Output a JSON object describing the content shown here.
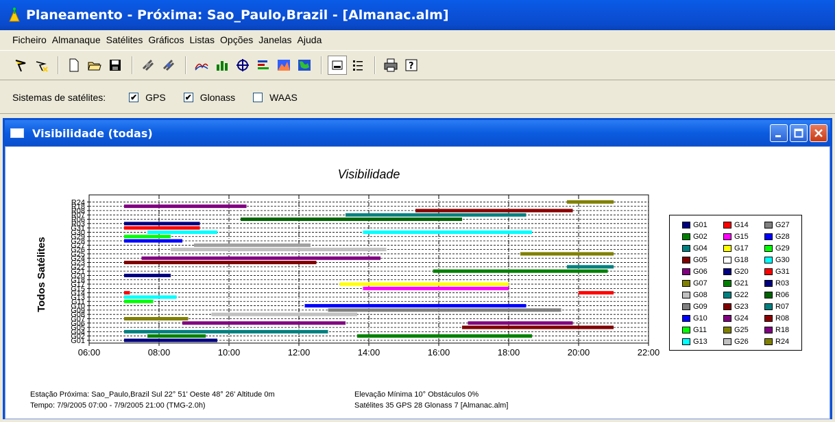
{
  "app": {
    "title": "Planeamento - Próxima: Sao_Paulo,Brazil - [Almanac.alm]"
  },
  "menu": [
    "Ficheiro",
    "Almanaque",
    "Satélites",
    "Gráficos",
    "Listas",
    "Opções",
    "Janelas",
    "Ajuda"
  ],
  "toolbar": {
    "icons": [
      "select-icon",
      "deselect-icon",
      "new-file-icon",
      "open-folder-icon",
      "save-icon",
      "satellite-icon",
      "satellite-alt-icon",
      "elevation-icon",
      "bar-chart-icon",
      "sky-plot-icon",
      "dop-icon",
      "visibility-icon",
      "world-map-icon",
      "view-toggle-icon",
      "list-icon",
      "print-icon",
      "help-icon"
    ]
  },
  "systems": {
    "label": "Sistemas de satélites:",
    "options": [
      {
        "label": "GPS",
        "checked": true
      },
      {
        "label": "Glonass",
        "checked": true
      },
      {
        "label": "WAAS",
        "checked": false
      }
    ]
  },
  "window": {
    "title": "Visibilidade (todas)"
  },
  "footer": {
    "line1_left": "Estação Próxima: Sao_Paulo,Brazil  Sul 22° 51'   Oeste 48° 26'   Altitude 0m",
    "line2_left": "Tempo: 7/9/2005 07:00 - 7/9/2005 21:00 (TMG-2.0h)",
    "line1_right": "Elevação Mínima 10°  Obstáculos 0%",
    "line2_right": "Satélites 35  GPS 28  Glonass 7  [Almanac.alm]"
  },
  "chart_data": {
    "type": "gantt",
    "title": "Visibilidade",
    "ylabel": "Todos Satélites",
    "xlabel": "",
    "x_range": [
      "06:00",
      "22:00"
    ],
    "x_ticks": [
      "06:00",
      "08:00",
      "10:00",
      "12:00",
      "14:00",
      "16:00",
      "18:00",
      "20:00",
      "22:00"
    ],
    "grid": true,
    "legend_position": "right",
    "rows": [
      {
        "name": "G01",
        "color": "#000080",
        "intervals": [
          [
            "07:00",
            "09:40"
          ]
        ]
      },
      {
        "name": "G02",
        "color": "#008000",
        "intervals": [
          [
            "07:40",
            "09:20"
          ],
          [
            "13:40",
            "18:40"
          ]
        ]
      },
      {
        "name": "G04",
        "color": "#008080",
        "intervals": [
          [
            "07:00",
            "12:50"
          ]
        ]
      },
      {
        "name": "G05",
        "color": "#800000",
        "intervals": [
          [
            "16:40",
            "21:00"
          ]
        ]
      },
      {
        "name": "G06",
        "color": "#800080",
        "intervals": [
          [
            "08:40",
            "13:20"
          ],
          [
            "16:50",
            "19:50"
          ]
        ]
      },
      {
        "name": "G07",
        "color": "#808000",
        "intervals": [
          [
            "07:00",
            "08:50"
          ]
        ]
      },
      {
        "name": "G08",
        "color": "#c0c0c0",
        "intervals": [
          [
            "09:30",
            "13:40"
          ]
        ]
      },
      {
        "name": "G09",
        "color": "#808080",
        "intervals": [
          [
            "12:50",
            "19:30"
          ]
        ]
      },
      {
        "name": "G10",
        "color": "#0000ff",
        "intervals": [
          [
            "12:10",
            "18:30"
          ]
        ]
      },
      {
        "name": "G11",
        "color": "#00ff00",
        "intervals": [
          [
            "07:00",
            "07:50"
          ]
        ]
      },
      {
        "name": "G13",
        "color": "#00ffff",
        "intervals": [
          [
            "07:00",
            "08:30"
          ]
        ]
      },
      {
        "name": "G14",
        "color": "#ff0000",
        "intervals": [
          [
            "07:00",
            "07:10"
          ],
          [
            "20:00",
            "21:00"
          ]
        ]
      },
      {
        "name": "G15",
        "color": "#ff00ff",
        "intervals": [
          [
            "13:50",
            "18:00"
          ]
        ]
      },
      {
        "name": "G17",
        "color": "#ffff00",
        "intervals": [
          [
            "13:10",
            "18:00"
          ]
        ]
      },
      {
        "name": "G18",
        "color": "#ffffff",
        "intervals": []
      },
      {
        "name": "G20",
        "color": "#000080",
        "intervals": [
          [
            "07:00",
            "08:20"
          ]
        ]
      },
      {
        "name": "G21",
        "color": "#008000",
        "intervals": [
          [
            "15:50",
            "20:50"
          ]
        ]
      },
      {
        "name": "G22",
        "color": "#008080",
        "intervals": [
          [
            "19:40",
            "21:00"
          ]
        ]
      },
      {
        "name": "G23",
        "color": "#800000",
        "intervals": [
          [
            "07:00",
            "12:30"
          ]
        ]
      },
      {
        "name": "G24",
        "color": "#800080",
        "intervals": [
          [
            "07:30",
            "14:20"
          ]
        ]
      },
      {
        "name": "G25",
        "color": "#808000",
        "intervals": [
          [
            "18:20",
            "21:00"
          ]
        ]
      },
      {
        "name": "G26",
        "color": "#c0c0c0",
        "intervals": [
          [
            "08:20",
            "14:30"
          ]
        ]
      },
      {
        "name": "G27",
        "color": "#a0a0a0",
        "intervals": [
          [
            "09:00",
            "12:20"
          ]
        ]
      },
      {
        "name": "G28",
        "color": "#0000ff",
        "intervals": [
          [
            "07:00",
            "08:40"
          ]
        ]
      },
      {
        "name": "G29",
        "color": "#00ff00",
        "intervals": [
          [
            "07:00",
            "08:20"
          ]
        ]
      },
      {
        "name": "G30",
        "color": "#00ffff",
        "intervals": [
          [
            "07:40",
            "09:40"
          ],
          [
            "13:50",
            "18:40"
          ]
        ]
      },
      {
        "name": "G31",
        "color": "#ff0000",
        "intervals": [
          [
            "07:00",
            "09:10"
          ]
        ]
      },
      {
        "name": "R03",
        "color": "#000080",
        "intervals": [
          [
            "07:00",
            "09:10"
          ]
        ]
      },
      {
        "name": "R06",
        "color": "#006400",
        "intervals": [
          [
            "10:20",
            "16:40"
          ]
        ]
      },
      {
        "name": "R07",
        "color": "#008080",
        "intervals": [
          [
            "13:20",
            "18:30"
          ]
        ]
      },
      {
        "name": "R08",
        "color": "#8b0000",
        "intervals": [
          [
            "15:20",
            "19:50"
          ]
        ]
      },
      {
        "name": "R18",
        "color": "#800080",
        "intervals": [
          [
            "07:00",
            "10:30"
          ]
        ]
      },
      {
        "name": "R24",
        "color": "#808000",
        "intervals": [
          [
            "19:40",
            "21:00"
          ]
        ]
      }
    ],
    "legend": [
      [
        "G01",
        "#000080"
      ],
      [
        "G14",
        "#ff0000"
      ],
      [
        "G27",
        "#808080"
      ],
      [
        "G02",
        "#008000"
      ],
      [
        "G15",
        "#ff00ff"
      ],
      [
        "G28",
        "#0000ff"
      ],
      [
        "G04",
        "#008080"
      ],
      [
        "G17",
        "#ffff00"
      ],
      [
        "G29",
        "#00ff00"
      ],
      [
        "G05",
        "#800000"
      ],
      [
        "G18",
        "#ffffff"
      ],
      [
        "G30",
        "#00ffff"
      ],
      [
        "G06",
        "#800080"
      ],
      [
        "G20",
        "#000080"
      ],
      [
        "G31",
        "#ff0000"
      ],
      [
        "G07",
        "#808000"
      ],
      [
        "G21",
        "#008000"
      ],
      [
        "R03",
        "#000080"
      ],
      [
        "G08",
        "#c0c0c0"
      ],
      [
        "G22",
        "#008080"
      ],
      [
        "R06",
        "#006400"
      ],
      [
        "G09",
        "#808080"
      ],
      [
        "G23",
        "#800000"
      ],
      [
        "R07",
        "#008080"
      ],
      [
        "G10",
        "#0000ff"
      ],
      [
        "G24",
        "#800080"
      ],
      [
        "R08",
        "#8b0000"
      ],
      [
        "G11",
        "#00ff00"
      ],
      [
        "G25",
        "#808000"
      ],
      [
        "R18",
        "#800080"
      ],
      [
        "G13",
        "#00ffff"
      ],
      [
        "G26",
        "#c0c0c0"
      ],
      [
        "R24",
        "#808000"
      ]
    ]
  }
}
